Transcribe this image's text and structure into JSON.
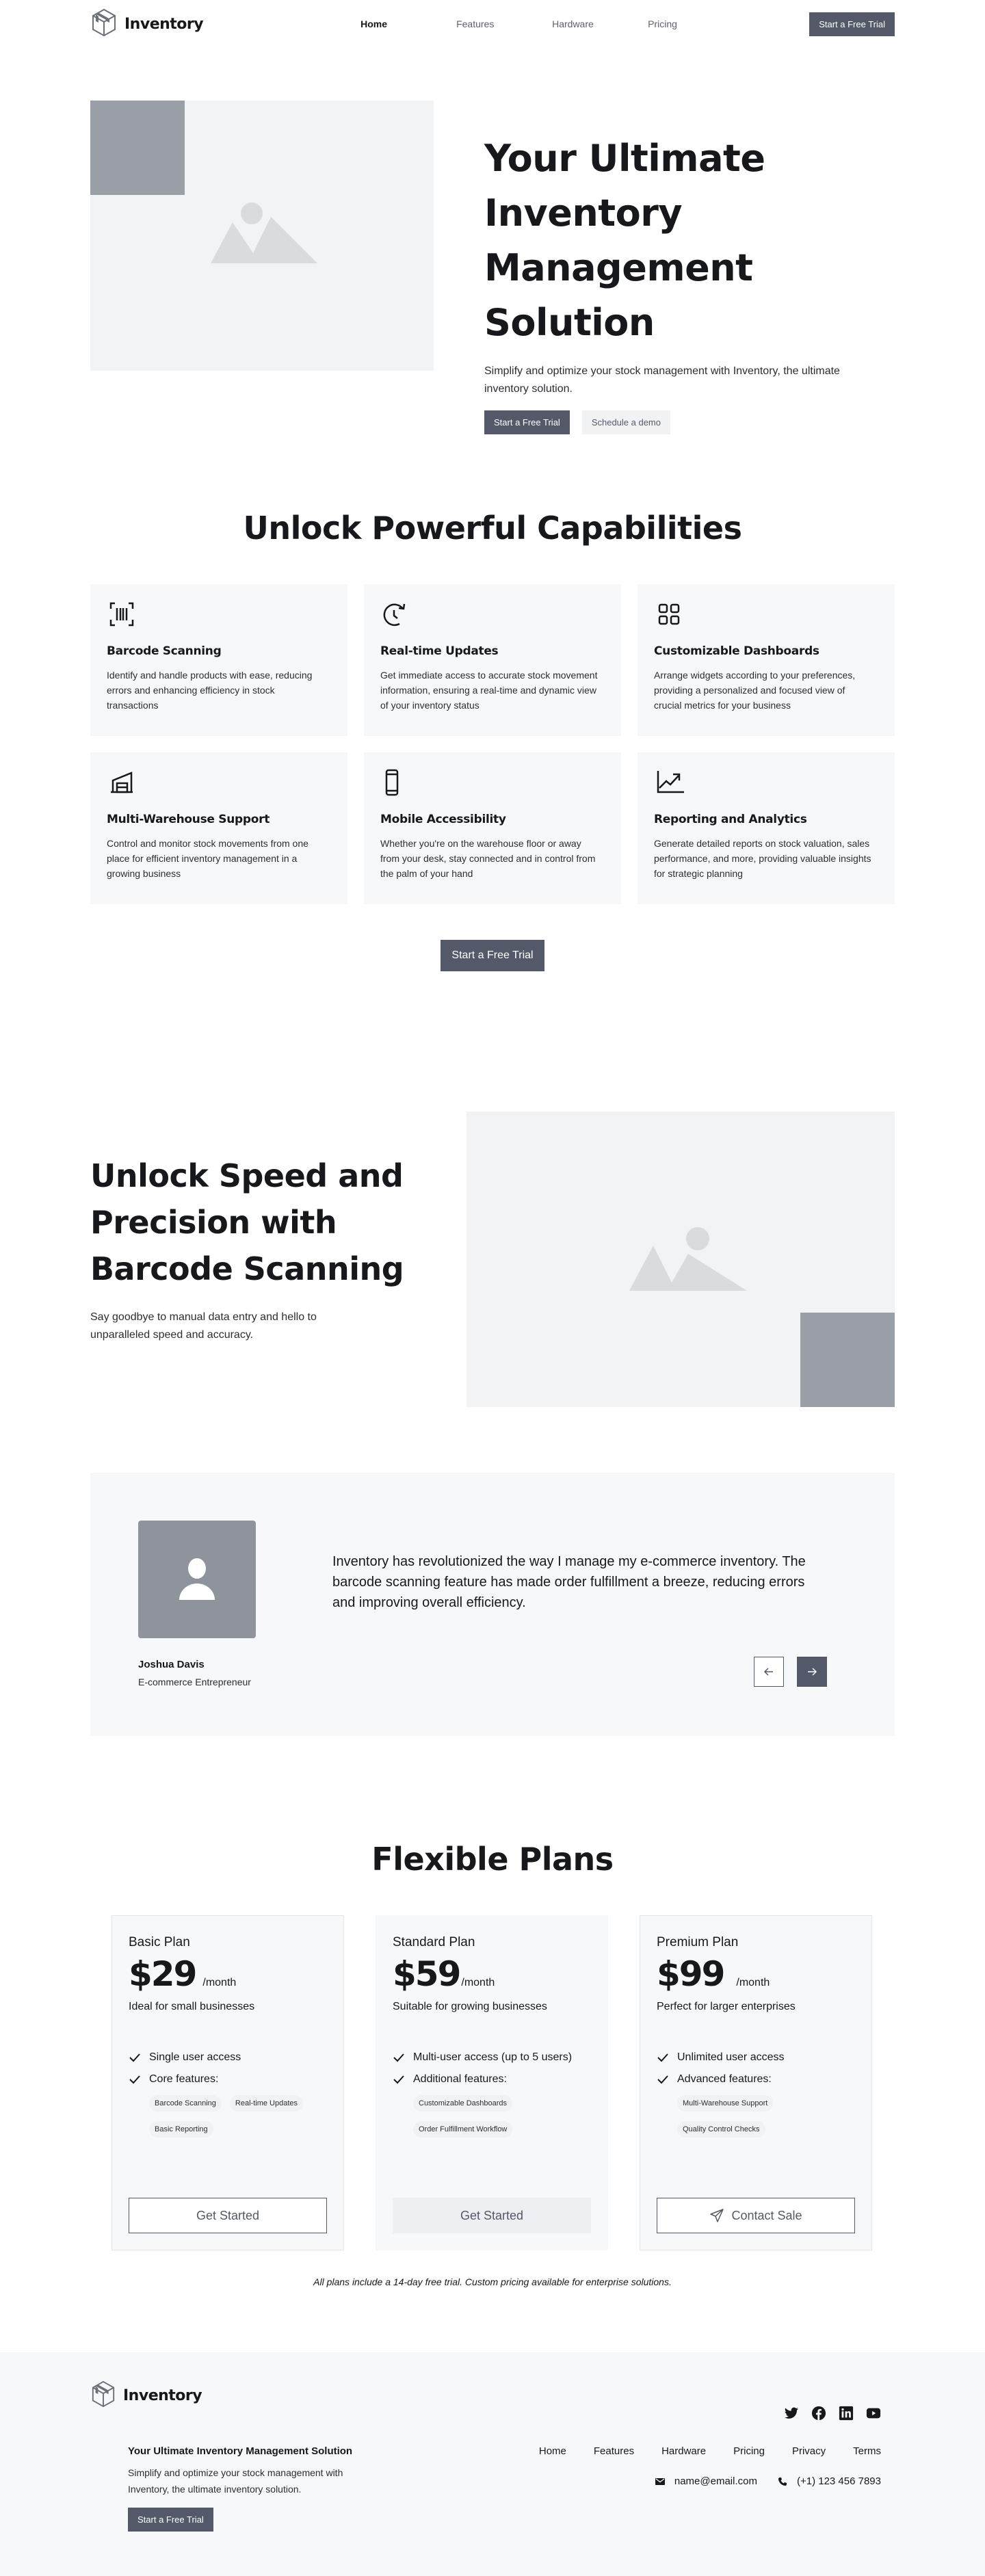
{
  "brand": {
    "name": "Inventory",
    "logo_icon": "package-box-icon"
  },
  "nav": {
    "links": [
      {
        "label": "Home",
        "active": true
      },
      {
        "label": "Features",
        "active": false
      },
      {
        "label": "Hardware",
        "active": false
      },
      {
        "label": "Pricing",
        "active": false
      }
    ],
    "cta_label": "Start a Free Trial"
  },
  "hero": {
    "title": "Your Ultimate Inventory Management Solution",
    "description": "Simplify and optimize your stock management with Inventory, the ultimate inventory solution.",
    "primary_button": "Start a Free Trial",
    "secondary_button": "Schedule a demo",
    "image_icon": "image-placeholder-icon"
  },
  "capabilities": {
    "title": "Unlock Powerful Capabilities",
    "items": [
      {
        "icon": "barcode-scan-icon",
        "title": "Barcode Scanning",
        "description": "Identify and handle products with ease, reducing errors and enhancing efficiency in stock transactions"
      },
      {
        "icon": "clock-refresh-icon",
        "title": "Real-time Updates",
        "description": "Get immediate access to accurate stock movement information, ensuring a real-time and dynamic view of your inventory status"
      },
      {
        "icon": "dashboard-grid-icon",
        "title": "Customizable Dashboards",
        "description": "Arrange widgets according to your preferences, providing a personalized and focused view of crucial metrics for your business"
      },
      {
        "icon": "warehouse-icon",
        "title": "Multi-Warehouse Support",
        "description": "Control and monitor stock movements from one place for efficient inventory management in a growing business"
      },
      {
        "icon": "mobile-phone-icon",
        "title": "Mobile Accessibility",
        "description": "Whether you're on the warehouse floor or away from your desk, stay connected and in control from the palm of your hand"
      },
      {
        "icon": "chart-trending-up-icon",
        "title": "Reporting and Analytics",
        "description": "Generate detailed reports on stock valuation, sales performance, and more, providing valuable insights for strategic planning"
      }
    ],
    "cta_label": "Start a Free Trial"
  },
  "barcode": {
    "title": "Unlock Speed and Precision with Barcode Scanning",
    "description": "Say goodbye to manual data entry and hello to unparalleled speed and accuracy."
  },
  "testimonial": {
    "quote": "Inventory has revolutionized the way I manage my e-commerce inventory. The barcode scanning feature has made order fulfillment a breeze, reducing errors and improving overall efficiency.",
    "name": "Joshua Davis",
    "role": "E-commerce Entrepreneur",
    "prev_icon": "arrow-left-icon",
    "next_icon": "arrow-right-icon"
  },
  "pricing": {
    "title": "Flexible Plans",
    "plans": [
      {
        "name": "Basic Plan",
        "price": "$29",
        "period": "/month",
        "tagline": "Ideal for small businesses",
        "features": [
          "Single user access",
          "Core features:"
        ],
        "chips": [
          "Barcode Scanning",
          "Real-time Updates",
          "Basic Reporting"
        ],
        "button": "Get Started",
        "button_style": "outline"
      },
      {
        "name": "Standard Plan",
        "price": "$59",
        "period": "/month",
        "tagline": "Suitable for growing businesses",
        "features": [
          "Multi-user access (up to 5 users)",
          "Additional features:"
        ],
        "chips": [
          "Customizable Dashboards",
          "Order Fulfillment Workflow"
        ],
        "button": "Get Started",
        "button_style": "filled"
      },
      {
        "name": "Premium Plan",
        "price": "$99",
        "period": "/month",
        "tagline": "Perfect for larger enterprises",
        "features": [
          "Unlimited user access",
          "Advanced features:"
        ],
        "chips": [
          "Multi-Warehouse Support",
          "Quality Control Checks"
        ],
        "button": "Contact Sale",
        "button_style": "outline",
        "button_icon": "send-icon"
      }
    ],
    "note": "All plans include a 14-day free trial. Custom pricing available for enterprise solutions."
  },
  "footer": {
    "brand": "Inventory",
    "title": "Your Ultimate Inventory Management Solution",
    "description": "Simplify and optimize your stock management with Inventory, the ultimate inventory solution.",
    "cta_label": "Start a Free Trial",
    "social": [
      "twitter-icon",
      "facebook-icon",
      "linkedin-icon",
      "youtube-icon"
    ],
    "links": [
      "Home",
      "Features",
      "Hardware",
      "Pricing",
      "Privacy",
      "Terms"
    ],
    "email": "name@email.com",
    "phone": "(+1) 123 456 7893"
  },
  "colors": {
    "primary": "#535968",
    "card_bg": "#f7f8fa",
    "placeholder_bg": "#f2f3f5",
    "accent_block": "#9a9ea6",
    "text": "#17181c"
  }
}
